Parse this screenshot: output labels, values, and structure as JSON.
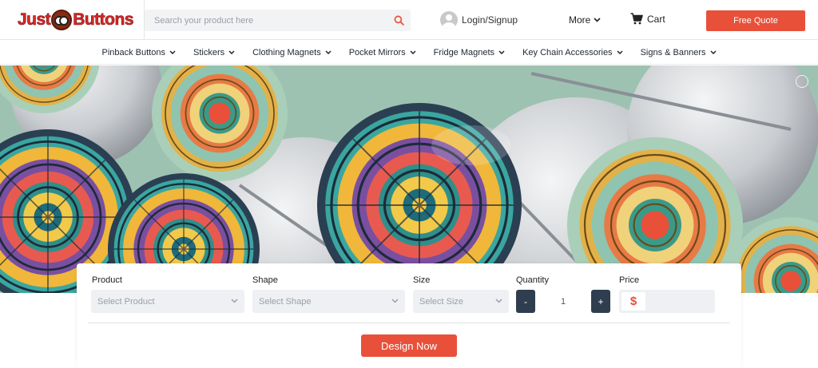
{
  "brand": {
    "logo_left": "Just",
    "logo_right": "Buttons"
  },
  "search": {
    "placeholder": "Search your product here"
  },
  "header": {
    "login_label": "Login/Signup",
    "more_label": "More",
    "cart_label": "Cart",
    "quote_label": "Free Quote"
  },
  "nav": {
    "items": [
      {
        "label": "Pinback Buttons"
      },
      {
        "label": "Stickers"
      },
      {
        "label": "Clothing Magnets"
      },
      {
        "label": "Pocket Mirrors"
      },
      {
        "label": "Fridge Magnets"
      },
      {
        "label": "Key Chain Accessories"
      },
      {
        "label": "Signs & Banners"
      }
    ]
  },
  "form": {
    "product": {
      "label": "Product",
      "value": "Select Product"
    },
    "shape": {
      "label": "Shape",
      "value": "Select Shape"
    },
    "size": {
      "label": "Size",
      "value": "Select Size"
    },
    "quantity": {
      "label": "Quantity",
      "value": "1",
      "minus": "-",
      "plus": "+"
    },
    "price": {
      "label": "Price",
      "symbol": "$"
    },
    "design_label": "Design Now"
  },
  "colors": {
    "accent": "#e8503a",
    "dark_button": "#2f3e4e",
    "field_bg": "#eef0f3"
  },
  "icons": [
    "search-icon",
    "user-avatar-icon",
    "chevron-down-icon",
    "cart-icon",
    "carousel-dot-icon"
  ]
}
